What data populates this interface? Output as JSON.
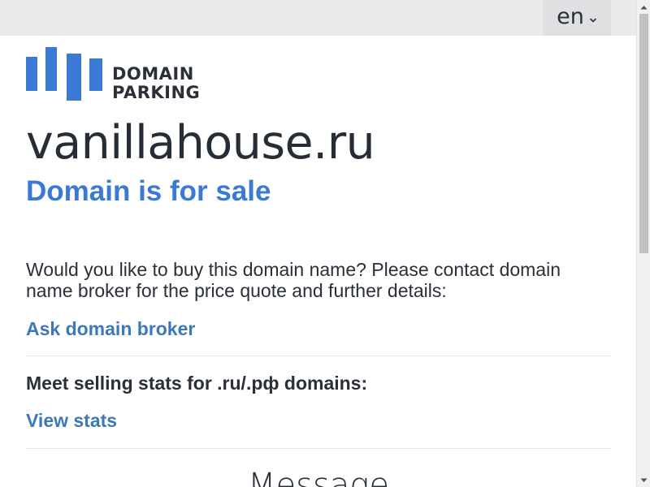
{
  "header": {
    "language": {
      "label": "en",
      "icon": "chevron-down-icon"
    }
  },
  "brand": {
    "logo_line1": "DOMAIN",
    "logo_line2": "PARKING",
    "accent_color": "#3a79d4"
  },
  "main": {
    "domain_name": "vanillahouse.ru",
    "status_text": "Domain is for sale",
    "description": "Would you like to buy this domain name? Please contact domain name broker for the price quote and further details:",
    "broker_link_label": "Ask domain broker",
    "stats_heading": "Meet selling stats for .ru/.рф domains:",
    "stats_link_label": "View stats",
    "message_heading": "Message"
  },
  "colors": {
    "text": "#2a2f38",
    "link": "#3d78b8",
    "topbar_bg": "#ebebec"
  }
}
